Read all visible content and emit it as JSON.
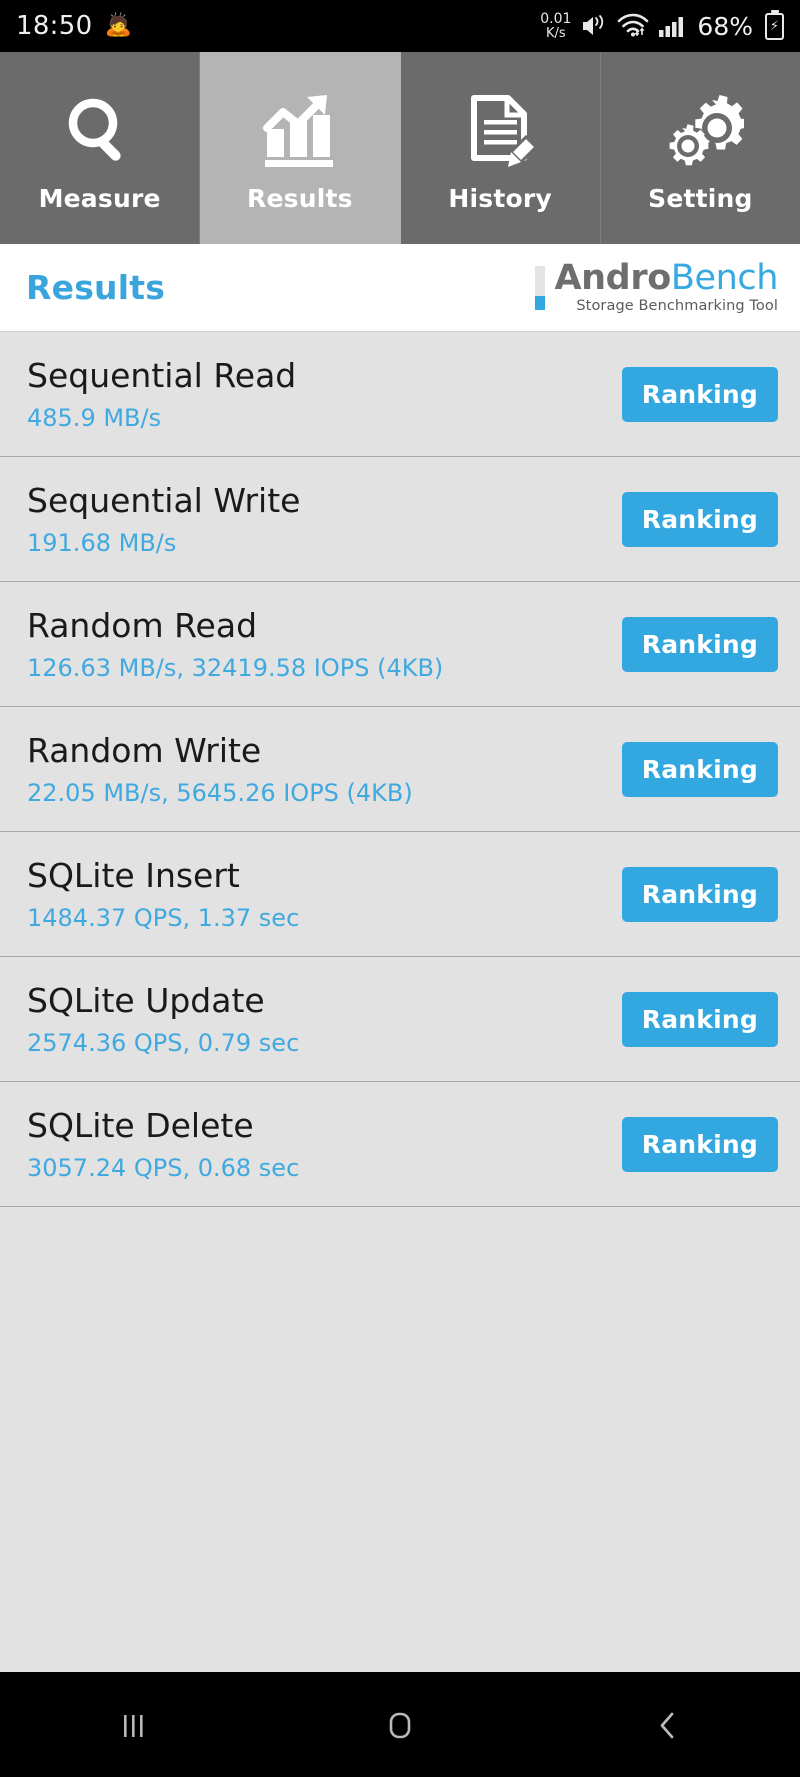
{
  "statusbar": {
    "time": "18:50",
    "emoji": "🙇",
    "netspeed_value": "0.01",
    "netspeed_unit": "K/s",
    "mute_icon": "volume-mute-icon",
    "wifi_icon": "wifi-icon",
    "signal_icon": "cellular-signal-icon",
    "battery_percent": "68%",
    "battery_icon": "battery-charging-icon"
  },
  "tabs": [
    {
      "label": "Measure",
      "icon": "magnifier-icon",
      "active": false
    },
    {
      "label": "Results",
      "icon": "bar-chart-trend-icon",
      "active": true
    },
    {
      "label": "History",
      "icon": "document-pencil-icon",
      "active": false
    },
    {
      "label": "Setting",
      "icon": "gears-icon",
      "active": false
    }
  ],
  "header": {
    "title": "Results",
    "logo_name_part1": "Andro",
    "logo_name_part2": "Bench",
    "logo_subtitle": "Storage Benchmarking Tool"
  },
  "results": [
    {
      "title": "Sequential Read",
      "value": "485.9 MB/s",
      "button": "Ranking"
    },
    {
      "title": "Sequential Write",
      "value": "191.68 MB/s",
      "button": "Ranking"
    },
    {
      "title": "Random Read",
      "value": "126.63 MB/s, 32419.58 IOPS (4KB)",
      "button": "Ranking"
    },
    {
      "title": "Random Write",
      "value": "22.05 MB/s, 5645.26 IOPS (4KB)",
      "button": "Ranking"
    },
    {
      "title": "SQLite Insert",
      "value": "1484.37 QPS, 1.37 sec",
      "button": "Ranking"
    },
    {
      "title": "SQLite Update",
      "value": "2574.36 QPS, 0.79 sec",
      "button": "Ranking"
    },
    {
      "title": "SQLite Delete",
      "value": "3057.24 QPS, 0.68 sec",
      "button": "Ranking"
    }
  ],
  "navbar": {
    "recents_icon": "recents-icon",
    "home_icon": "home-icon",
    "back_icon": "back-icon"
  },
  "colors": {
    "accent_blue": "#33a8e0",
    "tab_inactive": "#6b6b6b",
    "tab_active": "#b4b4b4",
    "list_bg": "#e2e2e2",
    "logo_gray": "#6e6e6e"
  }
}
